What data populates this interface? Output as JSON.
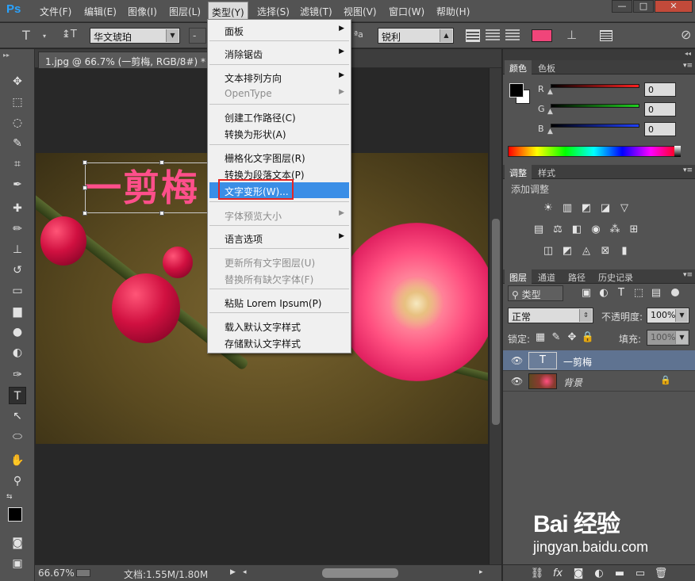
{
  "app": {
    "logo": "Ps"
  },
  "menubar": {
    "items": [
      "文件(F)",
      "编辑(E)",
      "图像(I)",
      "图层(L)",
      "类型(Y)",
      "选择(S)",
      "滤镜(T)",
      "视图(V)",
      "窗口(W)",
      "帮助(H)"
    ],
    "window_controls": [
      "—",
      "□",
      "✕"
    ]
  },
  "options": {
    "tool_glyph": "T",
    "orient_glyph": "↨T",
    "font_family": "华文琥珀",
    "font_style": "-",
    "aa_label": "ªa",
    "aa_value": "锐利",
    "text_color": "#f0457a"
  },
  "document": {
    "tab_title": "1.jpg @ 66.7% (一剪梅, RGB/8#) *",
    "tab_close": "×",
    "text_layer_content": "一剪梅"
  },
  "status": {
    "zoom": "66.67%",
    "doc_size": "文档:1.55M/1.80M"
  },
  "type_menu": {
    "items": [
      {
        "label": "面板",
        "submenu": true,
        "disabled": false
      },
      {
        "label": "消除锯齿",
        "submenu": true,
        "disabled": false
      },
      {
        "label": "文本排列方向",
        "submenu": true,
        "disabled": false
      },
      {
        "label": "OpenType",
        "submenu": true,
        "disabled": true
      },
      {
        "label": "创建工作路径(C)",
        "submenu": false,
        "disabled": false
      },
      {
        "label": "转换为形状(A)",
        "submenu": false,
        "disabled": false
      },
      {
        "label": "栅格化文字图层(R)",
        "submenu": false,
        "disabled": false
      },
      {
        "label": "转换为段落文本(P)",
        "submenu": false,
        "disabled": false
      },
      {
        "label": "文字变形(W)...",
        "submenu": false,
        "disabled": false,
        "highlighted": true
      },
      {
        "label": "字体预览大小",
        "submenu": true,
        "disabled": true
      },
      {
        "label": "语言选项",
        "submenu": true,
        "disabled": false
      },
      {
        "label": "更新所有文字图层(U)",
        "submenu": false,
        "disabled": true
      },
      {
        "label": "替换所有缺欠字体(F)",
        "submenu": false,
        "disabled": true
      },
      {
        "label": "粘贴 Lorem Ipsum(P)",
        "submenu": false,
        "disabled": false
      },
      {
        "label": "载入默认文字样式",
        "submenu": false,
        "disabled": false
      },
      {
        "label": "存储默认文字样式",
        "submenu": false,
        "disabled": false
      }
    ]
  },
  "color_panel": {
    "tabs": [
      "颜色",
      "色板"
    ],
    "channels": [
      {
        "label": "R",
        "value": "0",
        "color": "#ff2020"
      },
      {
        "label": "G",
        "value": "0",
        "color": "#20d020"
      },
      {
        "label": "B",
        "value": "0",
        "color": "#2040ff"
      }
    ]
  },
  "adjust_panel": {
    "tabs": [
      "调整",
      "样式"
    ],
    "title": "添加调整"
  },
  "layers_panel": {
    "tabs": [
      "图层",
      "通道",
      "路径",
      "历史记录"
    ],
    "filter_label": "类型",
    "blend_mode": "正常",
    "opacity_label": "不透明度:",
    "opacity_value": "100%",
    "lock_label": "锁定:",
    "fill_label": "填充:",
    "fill_value": "100%",
    "layers": [
      {
        "name": "一剪梅",
        "type_glyph": "T",
        "selected": true
      },
      {
        "name": "背景",
        "type_glyph": "",
        "selected": false,
        "locked": true
      }
    ]
  },
  "watermark": {
    "main": "Bai 经验",
    "url": "jingyan.baidu.com"
  }
}
